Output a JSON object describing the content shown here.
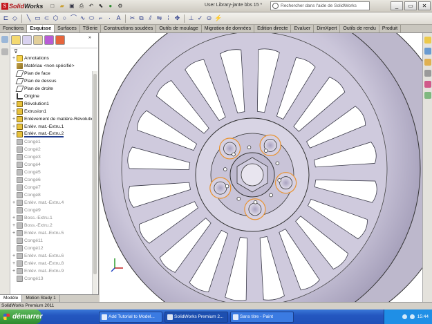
{
  "app": {
    "logo_mark": "S",
    "logo_text_a": "Solid",
    "logo_text_b": "Works",
    "document_title": "User Library-jante bbs 15 *",
    "search_placeholder": "Rechercher dans l'aide de SolidWorks"
  },
  "command_tabs": [
    {
      "label": "Fonctions",
      "active": false
    },
    {
      "label": "Esquisse",
      "active": true
    },
    {
      "label": "Surfaces",
      "active": false
    },
    {
      "label": "Tôlerie",
      "active": false
    },
    {
      "label": "Constructions soudées",
      "active": false
    },
    {
      "label": "Outils de moulage",
      "active": false
    },
    {
      "label": "Migration de données",
      "active": false
    },
    {
      "label": "Edition directe",
      "active": false
    },
    {
      "label": "Evaluer",
      "active": false
    },
    {
      "label": "DimXpert",
      "active": false
    },
    {
      "label": "Outils de rendu",
      "active": false
    },
    {
      "label": "Produit",
      "active": false
    }
  ],
  "feature_tree": [
    {
      "label": "Annotations",
      "icon": "annotations-icon",
      "kind": "warn",
      "expand": "+",
      "dim": false
    },
    {
      "label": "Matériau <non spécifié>",
      "icon": "material-icon",
      "kind": "mat",
      "expand": "",
      "dim": false
    },
    {
      "label": "Plan de face",
      "icon": "plane-icon",
      "kind": "plane",
      "expand": "",
      "dim": false
    },
    {
      "label": "Plan de dessus",
      "icon": "plane-icon",
      "kind": "plane",
      "expand": "",
      "dim": false
    },
    {
      "label": "Plan de droite",
      "icon": "plane-icon",
      "kind": "plane",
      "expand": "",
      "dim": false
    },
    {
      "label": "Origine",
      "icon": "origin-icon",
      "kind": "origin",
      "expand": "",
      "dim": false
    },
    {
      "label": "Révolution1",
      "icon": "revolve-icon",
      "kind": "feat",
      "expand": "+",
      "dim": false
    },
    {
      "label": "Extrusion1",
      "icon": "extrude-icon",
      "kind": "feat",
      "expand": "+",
      "dim": false
    },
    {
      "label": "Enlèvement de matière-Révolution",
      "icon": "cut-revolve-icon",
      "kind": "feat",
      "expand": "+",
      "dim": false
    },
    {
      "label": "Enlèv. mat.-Extru.1",
      "icon": "cut-extrude-icon",
      "kind": "feat",
      "expand": "+",
      "dim": false
    },
    {
      "label": "Enlèv. mat.-Extru.2",
      "icon": "cut-extrude-icon",
      "kind": "feat",
      "expand": "+",
      "dim": false,
      "selected": true
    },
    {
      "label": "Congé1",
      "icon": "fillet-icon",
      "kind": "fillet",
      "expand": "",
      "dim": true
    },
    {
      "label": "Congé2",
      "icon": "fillet-icon",
      "kind": "fillet",
      "expand": "",
      "dim": true
    },
    {
      "label": "Congé3",
      "icon": "fillet-icon",
      "kind": "fillet",
      "expand": "",
      "dim": true
    },
    {
      "label": "Congé4",
      "icon": "fillet-icon",
      "kind": "fillet",
      "expand": "",
      "dim": true
    },
    {
      "label": "Congé5",
      "icon": "fillet-icon",
      "kind": "fillet",
      "expand": "",
      "dim": true
    },
    {
      "label": "Congé6",
      "icon": "fillet-icon",
      "kind": "fillet",
      "expand": "",
      "dim": true
    },
    {
      "label": "Congé7",
      "icon": "fillet-icon",
      "kind": "fillet",
      "expand": "",
      "dim": true
    },
    {
      "label": "Congé8",
      "icon": "fillet-icon",
      "kind": "fillet",
      "expand": "",
      "dim": true
    },
    {
      "label": "Enlèv. mat.-Extru.4",
      "icon": "cut-extrude-icon",
      "kind": "fillet",
      "expand": "+",
      "dim": true
    },
    {
      "label": "Congé9",
      "icon": "fillet-icon",
      "kind": "fillet",
      "expand": "",
      "dim": true
    },
    {
      "label": "Boss.-Extru.1",
      "icon": "boss-extrude-icon",
      "kind": "fillet",
      "expand": "+",
      "dim": true
    },
    {
      "label": "Boss.-Extru.2",
      "icon": "boss-extrude-icon",
      "kind": "fillet",
      "expand": "+",
      "dim": true
    },
    {
      "label": "Enlèv. mat.-Extru.5",
      "icon": "cut-extrude-icon",
      "kind": "fillet",
      "expand": "+",
      "dim": true
    },
    {
      "label": "Congé11",
      "icon": "fillet-icon",
      "kind": "fillet",
      "expand": "",
      "dim": true
    },
    {
      "label": "Congé12",
      "icon": "fillet-icon",
      "kind": "fillet",
      "expand": "",
      "dim": true
    },
    {
      "label": "Enlèv. mat.-Extru.6",
      "icon": "cut-extrude-icon",
      "kind": "fillet",
      "expand": "+",
      "dim": true
    },
    {
      "label": "Enlèv. mat.-Extru.8",
      "icon": "cut-extrude-icon",
      "kind": "fillet",
      "expand": "+",
      "dim": true
    },
    {
      "label": "Enlèv. mat.-Extru.9",
      "icon": "cut-extrude-icon",
      "kind": "fillet",
      "expand": "+",
      "dim": true
    },
    {
      "label": "Congé13",
      "icon": "fillet-icon",
      "kind": "fillet",
      "expand": "",
      "dim": true
    }
  ],
  "bottom_tabs": [
    {
      "label": "Modèle",
      "active": true
    },
    {
      "label": "Motion Study 1",
      "active": false
    }
  ],
  "status_text": "SolidWorks Premium 2011",
  "taskbar": {
    "start_label": "démarrer",
    "items": [
      {
        "label": "Add Tutorial to Model...",
        "active": false
      },
      {
        "label": "SolidWorks Premium 2...",
        "active": true
      },
      {
        "label": "Sans titre - Paint",
        "active": false
      }
    ],
    "clock": "15:44"
  },
  "colors": {
    "selection_orange": "#e9922e",
    "part_gray": "#c6c2d4",
    "tree_selection": "#1f3b8c",
    "brand_red": "#c4161c"
  }
}
